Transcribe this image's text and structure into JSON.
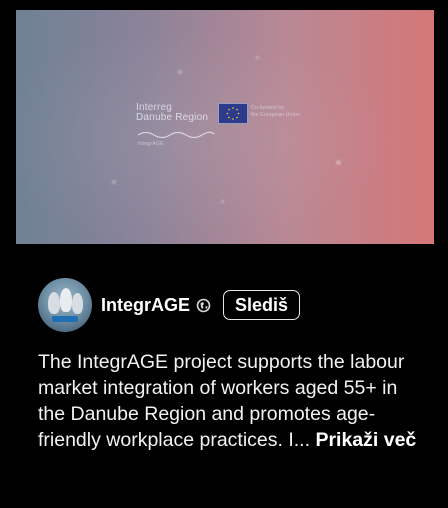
{
  "video": {
    "logo_line1": "Interreg",
    "logo_line2": "Danube Region",
    "eu_line1": "Co-funded by",
    "eu_line2": "the European Union",
    "tag": "IntegrAGE"
  },
  "channel": {
    "name": "IntegrAGE",
    "follow_label": "Slediš",
    "verified_icon": "globe-icon"
  },
  "description": {
    "text": "The IntegrAGE project supports the labour market integration of workers aged 55+ in the Danube Region and promotes age-friendly workplace practices. I...",
    "more_label": "Prikaži več"
  },
  "colors": {
    "background": "#000000",
    "gradient_left": "#6f8194",
    "gradient_right": "#d47778",
    "text": "#ffffff"
  }
}
